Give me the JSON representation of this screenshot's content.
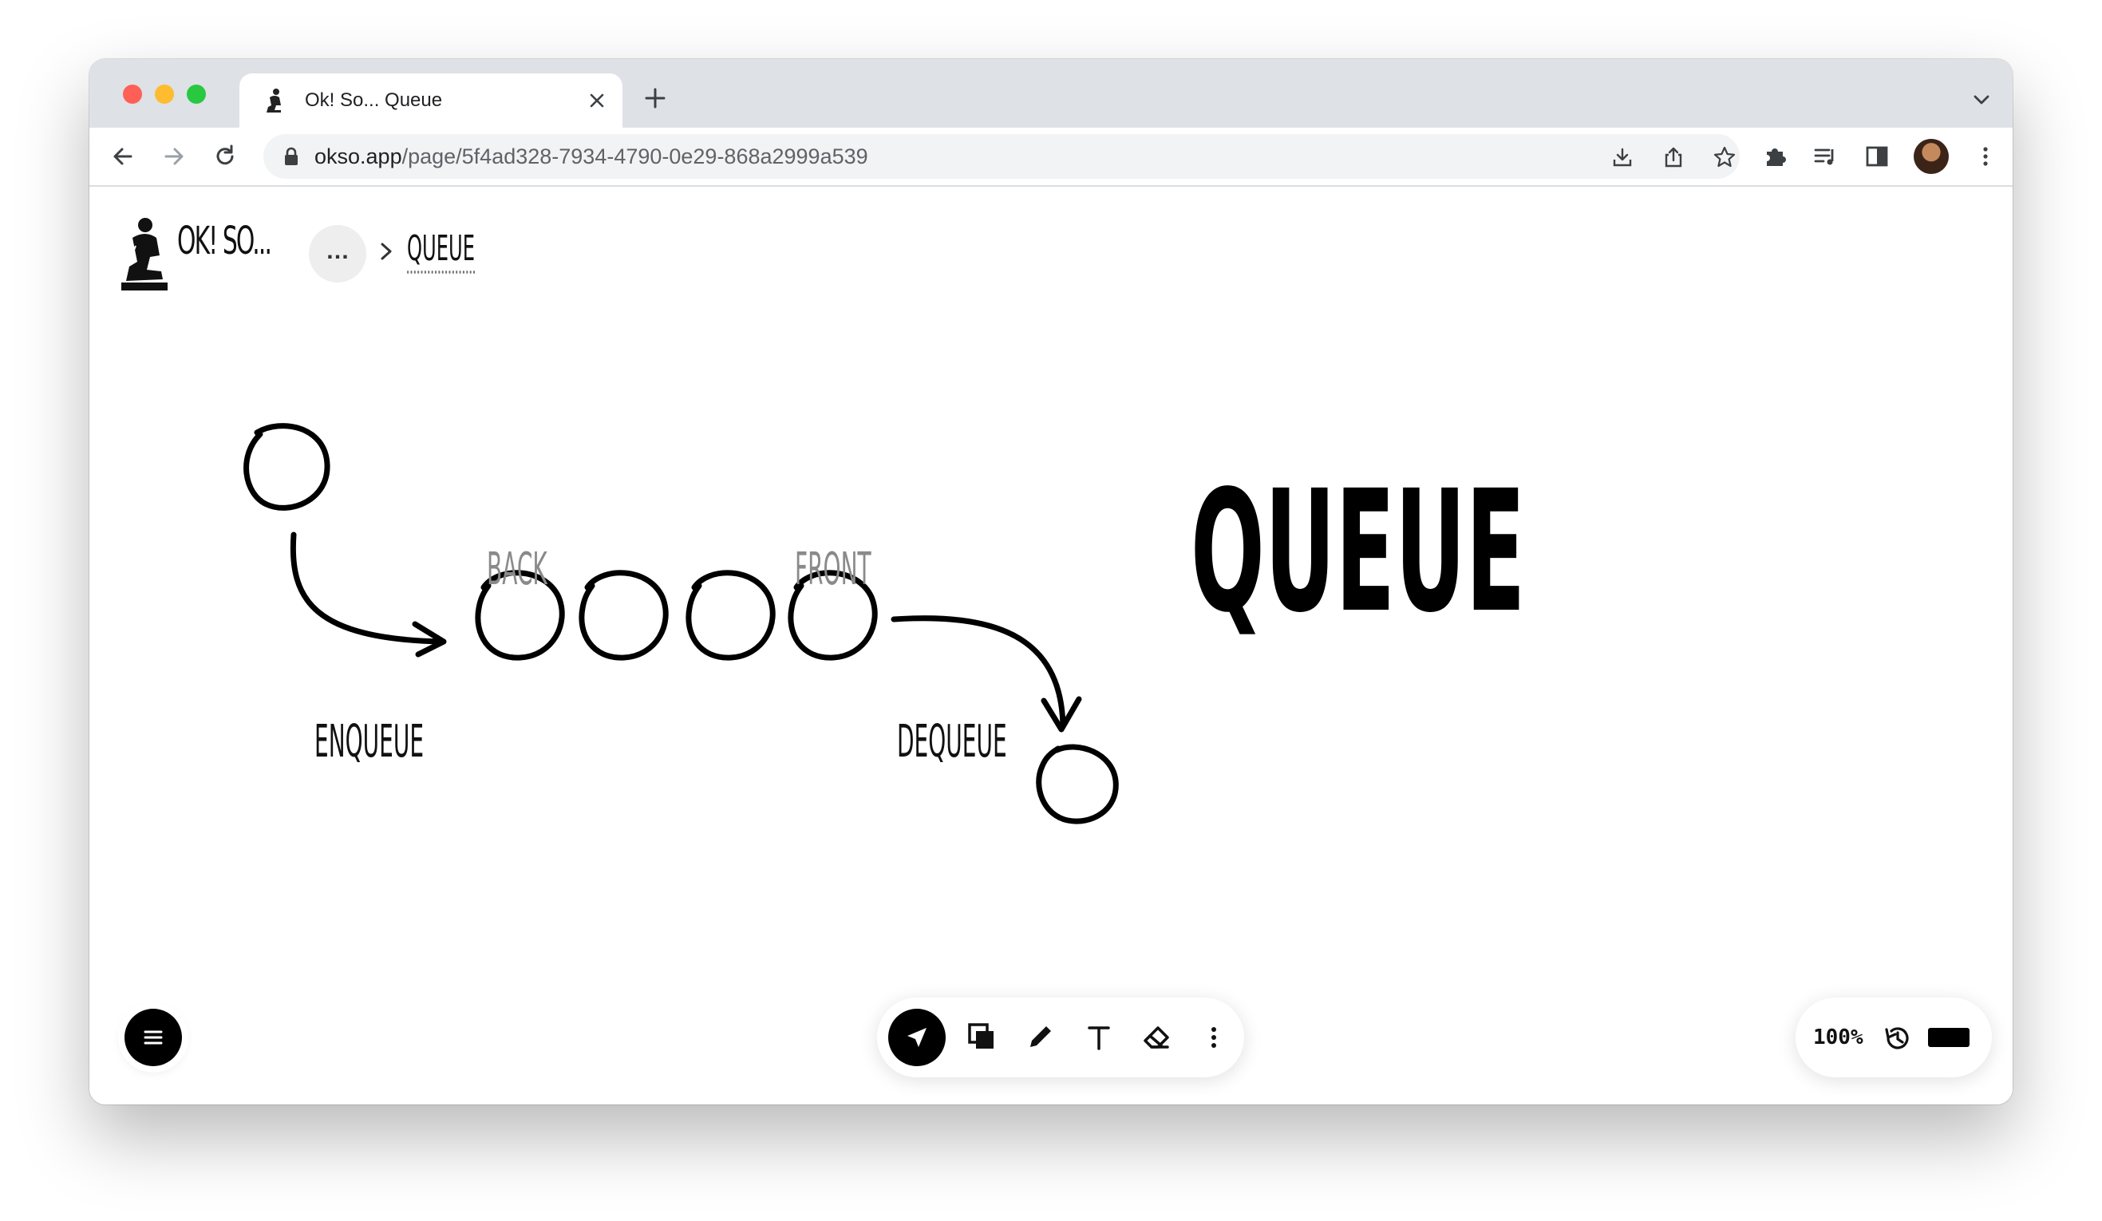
{
  "browser": {
    "tab_title": "Ok! So... Queue",
    "url_host": "okso.app",
    "url_path": "/page/5f4ad328-7934-4790-0e29-868a2999a539"
  },
  "app": {
    "brand": "OK! SO...",
    "more_label": "…",
    "breadcrumb": "QUEUE"
  },
  "drawing": {
    "title": "QUEUE",
    "label_back": "BACK",
    "label_front": "FRONT",
    "label_enqueue": "ENQUEUE",
    "label_dequeue": "DEQUEUE"
  },
  "status": {
    "zoom": "100%",
    "stroke_color": "#000000"
  },
  "icons": [
    "back-arrow-icon",
    "forward-arrow-icon",
    "reload-icon",
    "lock-icon",
    "install-icon",
    "share-icon",
    "star-icon",
    "extensions-icon",
    "media-icon",
    "sidepanel-icon",
    "kebab-icon",
    "select-tool-icon",
    "shapes-tool-icon",
    "pen-tool-icon",
    "text-tool-icon",
    "eraser-tool-icon",
    "history-icon",
    "menu-icon"
  ]
}
